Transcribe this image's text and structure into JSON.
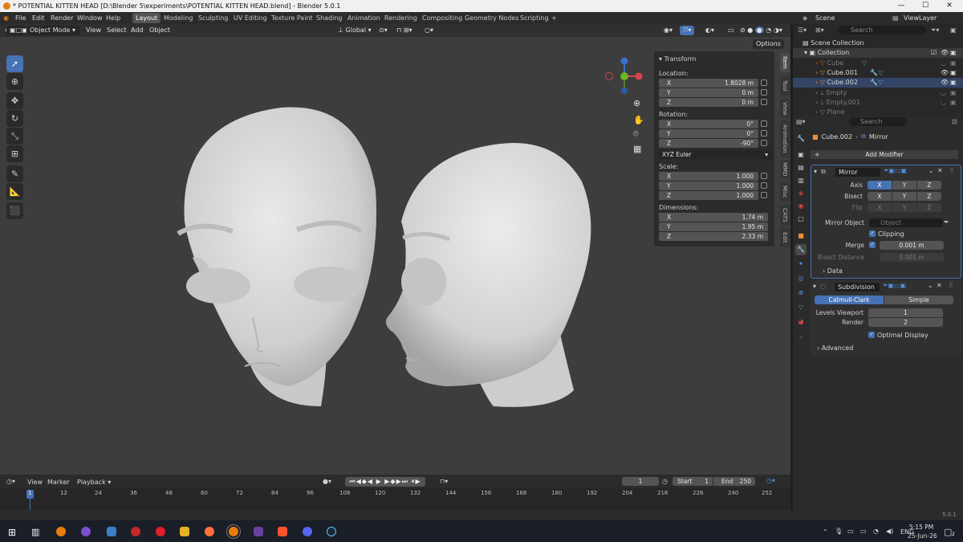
{
  "title_bar": {
    "title": "* POTENTIAL KITTEN HEAD [D:\\Blender 5\\experiments\\POTENTIAL KITTEN HEAD.blend] - Blender 5.0.1",
    "min": "—",
    "max": "☐",
    "close": "✕"
  },
  "menu": [
    "File",
    "Edit",
    "Render",
    "Window",
    "Help"
  ],
  "workspaces": [
    "Layout",
    "Modeling",
    "Sculpting",
    "UV Editing",
    "Texture Paint",
    "Shading",
    "Animation",
    "Rendering",
    "Compositing",
    "Geometry Nodes",
    "Scripting"
  ],
  "add_workspace": "+",
  "scene": {
    "label": "Scene",
    "view_layer": "ViewLayer"
  },
  "header": {
    "mode": "Object Mode",
    "menus": [
      "View",
      "Select",
      "Add",
      "Object"
    ],
    "orientation": "Global",
    "options": "Options"
  },
  "n_panel": {
    "section": "Transform",
    "location_label": "Location:",
    "location": [
      {
        "k": "X",
        "v": "1.8028 m"
      },
      {
        "k": "Y",
        "v": "0 m"
      },
      {
        "k": "Z",
        "v": "0 m"
      }
    ],
    "rotation_label": "Rotation:",
    "rotation": [
      {
        "k": "X",
        "v": "0°"
      },
      {
        "k": "Y",
        "v": "0°"
      },
      {
        "k": "Z",
        "v": "-90°"
      }
    ],
    "rotation_mode": "XYZ Euler",
    "scale_label": "Scale:",
    "scale": [
      {
        "k": "X",
        "v": "1.000"
      },
      {
        "k": "Y",
        "v": "1.000"
      },
      {
        "k": "Z",
        "v": "1.000"
      }
    ],
    "dimensions_label": "Dimensions:",
    "dimensions": [
      {
        "k": "X",
        "v": "1.74 m"
      },
      {
        "k": "Y",
        "v": "1.95 m"
      },
      {
        "k": "Z",
        "v": "2.33 m"
      }
    ],
    "tabs": [
      "Item",
      "Tool",
      "View",
      "Animation",
      "MMD",
      "Misc",
      "CATS",
      "Edit"
    ]
  },
  "outliner": {
    "search_placeholder": "Search",
    "root": "Scene Collection",
    "collection": "Collection",
    "items": [
      "Cube",
      "Cube.001",
      "Cube.002",
      "Empty",
      "Empty.001",
      "Plane"
    ]
  },
  "properties": {
    "search_placeholder": "Search",
    "breadcrumb_object": "Cube.002",
    "breadcrumb_modifier": "Mirror",
    "add_modifier": "Add Modifier",
    "mirror": {
      "name": "Mirror",
      "axis_label": "Axis",
      "bisect_label": "Bisect",
      "flip_label": "Flip",
      "x": "X",
      "y": "Y",
      "z": "Z",
      "mirror_object_label": "Mirror Object",
      "mirror_object_placeholder": "Object",
      "clipping_label": "Clipping",
      "merge_label": "Merge",
      "merge_value": "0.001 m",
      "bisect_distance_label": "Bisect Distance",
      "bisect_distance_value": "0.001 m",
      "data_label": "Data"
    },
    "subdivision": {
      "name": "Subdivision",
      "catmull": "Catmull-Clark",
      "simple": "Simple",
      "levels_viewport_label": "Levels Viewport",
      "levels_viewport": "1",
      "render_label": "Render",
      "render": "2",
      "optimal_label": "Optimal Display",
      "advanced_label": "Advanced"
    }
  },
  "timeline": {
    "menus": [
      "View",
      "Marker",
      "Playback"
    ],
    "current_frame": "1",
    "start_label": "Start",
    "start": "1",
    "end_label": "End",
    "end": "250",
    "ticks": [
      "1",
      "12",
      "24",
      "36",
      "48",
      "60",
      "72",
      "84",
      "96",
      "108",
      "120",
      "132",
      "144",
      "156",
      "168",
      "180",
      "192",
      "204",
      "216",
      "228",
      "240",
      "252"
    ]
  },
  "status": {
    "version": "5.0.1"
  },
  "taskbar": {
    "lang": "ENG",
    "time": "5:15 PM",
    "date": "25-Jun-26",
    "notif": "2"
  },
  "colors": {
    "accent": "#4772b3",
    "viewport": "#3d3d3d",
    "orange": "#e87d0d"
  }
}
